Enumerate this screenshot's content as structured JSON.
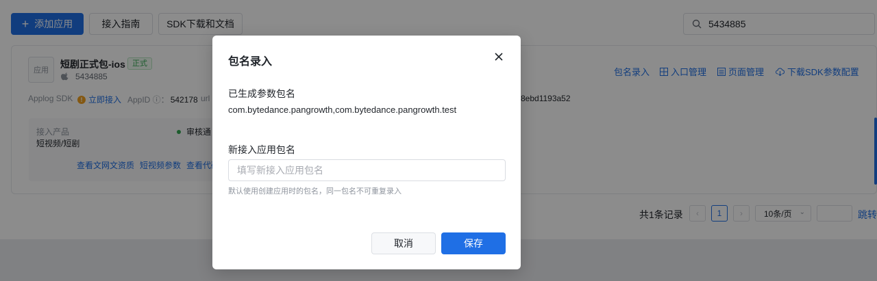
{
  "toolbar": {
    "add_app_label": "添加应用",
    "guide_label": "接入指南",
    "sdk_label": "SDK下载和文档",
    "search_value": "5434885"
  },
  "app_card": {
    "avatar_text": "应用",
    "name": "短剧正式包-ios",
    "tag": "正式",
    "app_id": "5434885",
    "actions": {
      "package_entry": "包名录入",
      "entry_manage": "入口管理",
      "page_manage": "页面管理",
      "download_sdk_config": "下载SDK参数配置"
    },
    "meta": {
      "sdk_label": "Applog SDK",
      "connect_now": "立即接入",
      "appid_label": "AppID ⓘ：",
      "appid_value": "542178",
      "url_label": "url",
      "hash_fragment": "8ebd1193a52"
    },
    "product": {
      "label": "接入产品",
      "value": "短视频/短剧",
      "status": "审核通",
      "links": [
        "查看文网文资质",
        "短视频参数",
        "查看代码"
      ]
    }
  },
  "pagination": {
    "total_text": "共1条记录",
    "current_page": "1",
    "page_size": "10条/页",
    "jump_label": "跳转"
  },
  "modal": {
    "title": "包名录入",
    "generated_label": "已生成参数包名",
    "generated_value": "com.bytedance.pangrowth,com.bytedance.pangrowth.test",
    "new_label": "新接入应用包名",
    "new_placeholder": "填写新接入应用包名",
    "new_value": "",
    "hint": "默认使用创建应用时的包名，同一包名不可重复录入",
    "cancel_label": "取消",
    "save_label": "保存"
  },
  "colors": {
    "primary": "#1f6fe5",
    "success": "#34a853",
    "warning": "#f0a020",
    "mask": "rgba(0,0,0,0.45)"
  },
  "icons": [
    "plus-icon",
    "search-icon",
    "apple-icon",
    "grid-icon",
    "page-icon",
    "cloud-download-icon",
    "warning-icon",
    "close-icon",
    "caret-down-icon"
  ]
}
